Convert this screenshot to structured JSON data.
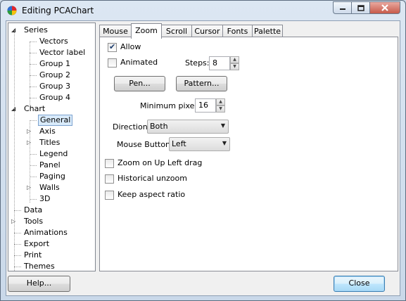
{
  "window": {
    "title": "Editing PCAChart"
  },
  "tree": {
    "items": [
      {
        "label": "Series",
        "glyph": "expanded"
      },
      {
        "label": "Vectors"
      },
      {
        "label": "Vector label"
      },
      {
        "label": "Group 1"
      },
      {
        "label": "Group 2"
      },
      {
        "label": "Group 3"
      },
      {
        "label": "Group 4"
      },
      {
        "label": "Chart",
        "glyph": "expanded"
      },
      {
        "label": "General",
        "selected": true
      },
      {
        "label": "Axis",
        "glyph": "collapsed"
      },
      {
        "label": "Titles",
        "glyph": "collapsed"
      },
      {
        "label": "Legend"
      },
      {
        "label": "Panel"
      },
      {
        "label": "Paging"
      },
      {
        "label": "Walls",
        "glyph": "collapsed"
      },
      {
        "label": "3D"
      },
      {
        "label": "Data"
      },
      {
        "label": "Tools",
        "glyph": "collapsed"
      },
      {
        "label": "Animations"
      },
      {
        "label": "Export"
      },
      {
        "label": "Print"
      },
      {
        "label": "Themes"
      }
    ]
  },
  "tabs": [
    "Mouse",
    "Zoom",
    "Scroll",
    "Cursor",
    "Fonts",
    "Palette"
  ],
  "active_tab": "Zoom",
  "zoom": {
    "allow_label": "Allow",
    "allow_checked": true,
    "animated_label": "Animated",
    "animated_checked": false,
    "steps_label": "Steps:",
    "steps_value": "8",
    "pen_button": "Pen...",
    "pattern_button": "Pattern...",
    "min_pixels_label": "Minimum pixels:",
    "min_pixels_value": "16",
    "direction_label": "Direction:",
    "direction_value": "Both",
    "mouse_button_label": "Mouse Button:",
    "mouse_button_value": "Left",
    "zoom_up_left_label": "Zoom on Up Left drag",
    "zoom_up_left_checked": false,
    "historical_label": "Historical unzoom",
    "historical_checked": false,
    "keep_aspect_label": "Keep aspect ratio",
    "keep_aspect_checked": false
  },
  "footer": {
    "help_button": "Help...",
    "close_button": "Close"
  }
}
